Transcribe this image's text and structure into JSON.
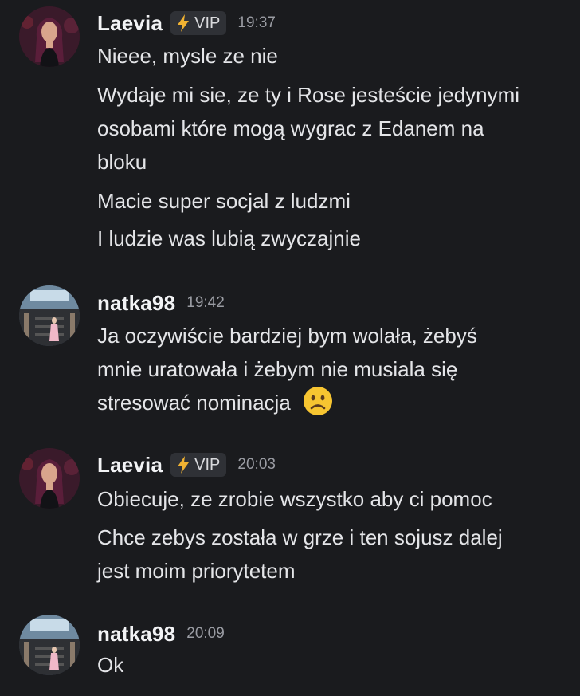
{
  "messages": [
    {
      "username": "Laevia",
      "vip_label": "VIP",
      "time": "19:37",
      "lines": [
        "Nieee, mysle ze nie",
        "Wydaje mi sie, ze ty i Rose jesteście jedynymi",
        "osobami które mogą wygrac z Edanem na",
        "bloku",
        "Macie super socjal z ludzmi",
        "I ludzie was lubią zwyczajnie"
      ]
    },
    {
      "username": "natka98",
      "time": "19:42",
      "lines": [
        "Ja oczywiście bardziej bym wolała, żebyś",
        "mnie uratowała i żebym nie musiala się",
        "stresować nominacja"
      ]
    },
    {
      "username": "Laevia",
      "vip_label": "VIP",
      "time": "20:03",
      "lines": [
        "Obiecuje, ze zrobie wszystko aby ci pomoc",
        "Chce zebys została w grze i ten sojusz dalej",
        "jest moim priorytetem"
      ]
    },
    {
      "username": "natka98",
      "time": "20:09",
      "lines": [
        "Ok"
      ]
    }
  ],
  "icons": {
    "vip": "lightning-bolt-icon",
    "emoji": "slightly-frowning-face-icon"
  },
  "colors": {
    "background": "#1a1b1e",
    "vip_bolt": "#f0b232",
    "emoji": "#f7c531"
  }
}
